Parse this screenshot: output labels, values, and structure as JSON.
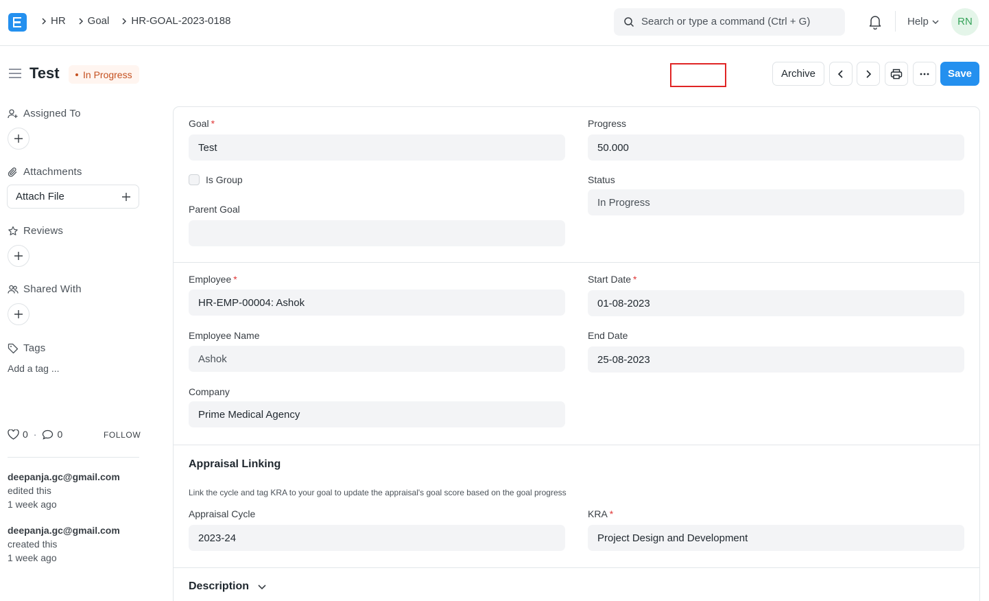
{
  "navbar": {
    "breadcrumbs": [
      "HR",
      "Goal",
      "HR-GOAL-2023-0188"
    ],
    "search_placeholder": "Search or type a command (Ctrl + G)",
    "help_label": "Help",
    "avatar_initials": "RN"
  },
  "page": {
    "title": "Test",
    "status": "In Progress",
    "actions": {
      "archive": "Archive",
      "save": "Save"
    }
  },
  "sidebar": {
    "assigned_to": "Assigned To",
    "attachments": "Attachments",
    "attach_file": "Attach File",
    "reviews": "Reviews",
    "shared_with": "Shared With",
    "tags": "Tags",
    "add_tag": "Add a tag ...",
    "likes": "0",
    "comments": "0",
    "follow": "FOLLOW",
    "activity": [
      {
        "user": "deepanja.gc@gmail.com",
        "action": "edited this",
        "time": "1 week ago"
      },
      {
        "user": "deepanja.gc@gmail.com",
        "action": "created this",
        "time": "1 week ago"
      }
    ]
  },
  "form": {
    "goal": {
      "label": "Goal",
      "value": "Test"
    },
    "progress": {
      "label": "Progress",
      "value": "50.000"
    },
    "is_group": {
      "label": "Is Group",
      "checked": false
    },
    "status": {
      "label": "Status",
      "value": "In Progress"
    },
    "parent_goal": {
      "label": "Parent Goal",
      "value": ""
    },
    "employee": {
      "label": "Employee",
      "value": "HR-EMP-00004: Ashok"
    },
    "start_date": {
      "label": "Start Date",
      "value": "01-08-2023"
    },
    "employee_name": {
      "label": "Employee Name",
      "value": "Ashok"
    },
    "end_date": {
      "label": "End Date",
      "value": "25-08-2023"
    },
    "company": {
      "label": "Company",
      "value": "Prime Medical Agency"
    },
    "appraisal_section": {
      "title": "Appraisal Linking",
      "description": "Link the cycle and tag KRA to your goal to update the appraisal's goal score based on the goal progress"
    },
    "appraisal_cycle": {
      "label": "Appraisal Cycle",
      "value": "2023-24"
    },
    "kra": {
      "label": "KRA",
      "value": "Project Design and Development"
    },
    "description_section": {
      "title": "Description"
    }
  },
  "colors": {
    "primary": "#2490ef",
    "status_text": "#c4501f",
    "status_bg": "#fff5f0",
    "required": "#e03636",
    "highlight_box": "#e02424"
  }
}
